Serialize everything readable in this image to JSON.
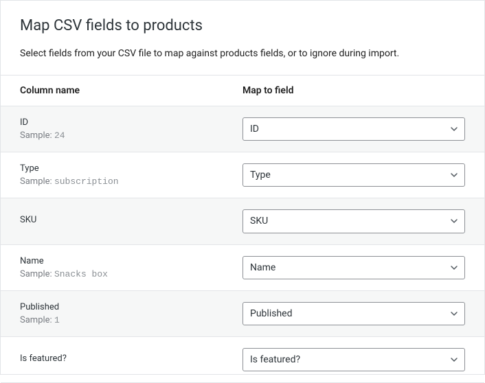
{
  "header": {
    "title": "Map CSV fields to products",
    "description": "Select fields from your CSV file to map against products fields, or to ignore during import."
  },
  "table": {
    "columns": {
      "name": "Column name",
      "map": "Map to field"
    },
    "sample_prefix": "Sample:",
    "rows": [
      {
        "label": "ID",
        "sample": "24",
        "selected": "ID"
      },
      {
        "label": "Type",
        "sample": "subscription",
        "selected": "Type"
      },
      {
        "label": "SKU",
        "sample": "",
        "selected": "SKU"
      },
      {
        "label": "Name",
        "sample": "Snacks box",
        "selected": "Name"
      },
      {
        "label": "Published",
        "sample": "1",
        "selected": "Published"
      },
      {
        "label": "Is featured?",
        "sample": "",
        "selected": "Is featured?"
      }
    ]
  }
}
